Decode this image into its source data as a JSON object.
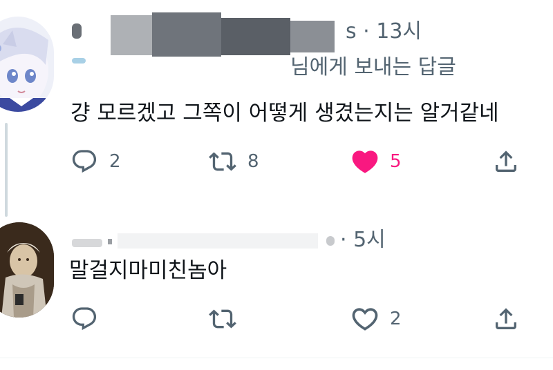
{
  "tweet1": {
    "time": "s · 13시",
    "reply_to": "님에게 보내는 답글",
    "text": "걍 모르겠고 그쪽이 어떻게 생겼는지는 알거같네",
    "actions": {
      "reply_count": "2",
      "retweet_count": "8",
      "like_count": "5",
      "liked": true
    }
  },
  "tweet2": {
    "time": "· 5시",
    "text": "말걸지마미친놈아",
    "actions": {
      "reply_count": "",
      "retweet_count": "",
      "like_count": "2",
      "liked": false
    }
  },
  "colors": {
    "text": "#0f1419",
    "secondary": "#536471",
    "like": "#f91880",
    "thread_line": "#cfd9de"
  },
  "icons": [
    "reply-icon",
    "retweet-icon",
    "heart-icon",
    "share-icon"
  ]
}
